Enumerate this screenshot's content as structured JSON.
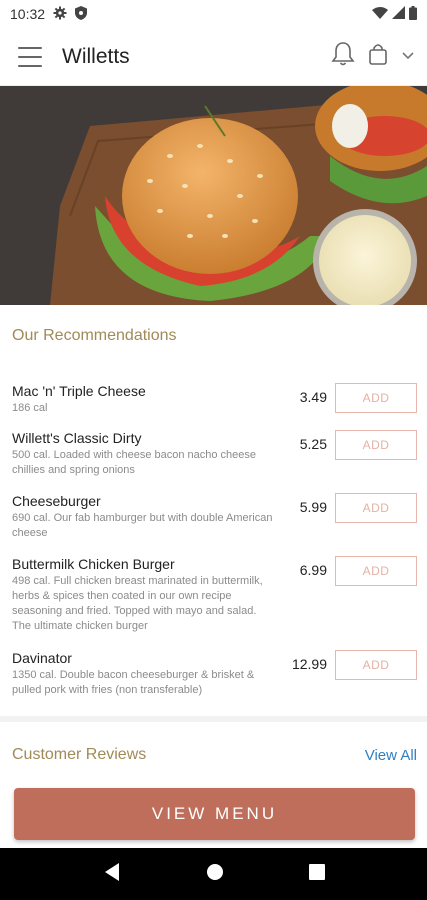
{
  "status_bar": {
    "time": "10:32"
  },
  "header": {
    "title": "Willetts"
  },
  "recommendations": {
    "title": "Our Recommendations",
    "items": [
      {
        "name": "Mac 'n' Triple Cheese",
        "desc": "186 cal",
        "price": "3.49",
        "button": "ADD"
      },
      {
        "name": "Willett's Classic Dirty",
        "desc": "500 cal. Loaded with cheese bacon nacho cheese chillies and spring onions",
        "price": "5.25",
        "button": "ADD"
      },
      {
        "name": "Cheeseburger",
        "desc": "690 cal. Our fab hamburger but with double American cheese",
        "price": "5.99",
        "button": "ADD"
      },
      {
        "name": "Buttermilk Chicken Burger",
        "desc": "498 cal. Full chicken breast marinated in buttermilk, herbs & spices then coated in our own recipe seasoning and fried. Topped with mayo and salad. The ultimate chicken burger",
        "price": "6.99",
        "button": "ADD"
      },
      {
        "name": "Davinator",
        "desc": "1350 cal. Double bacon cheeseburger & brisket & pulled pork with fries (non transferable)",
        "price": "12.99",
        "button": "ADD"
      }
    ]
  },
  "reviews": {
    "title": "Customer Reviews",
    "view_all": "View All"
  },
  "cta": {
    "label": "VIEW MENU"
  },
  "colors": {
    "accent": "#c06e5c",
    "section_title": "#a08a57",
    "link": "#2f7fc0",
    "add_border": "#e6b8ad"
  },
  "icons": [
    "settings-icon",
    "shield-icon",
    "wifi-icon",
    "signal-icon",
    "battery-icon",
    "menu-icon",
    "bell-icon",
    "shopping-bag-icon",
    "chevron-down-icon",
    "back-icon",
    "home-icon",
    "recents-icon"
  ]
}
